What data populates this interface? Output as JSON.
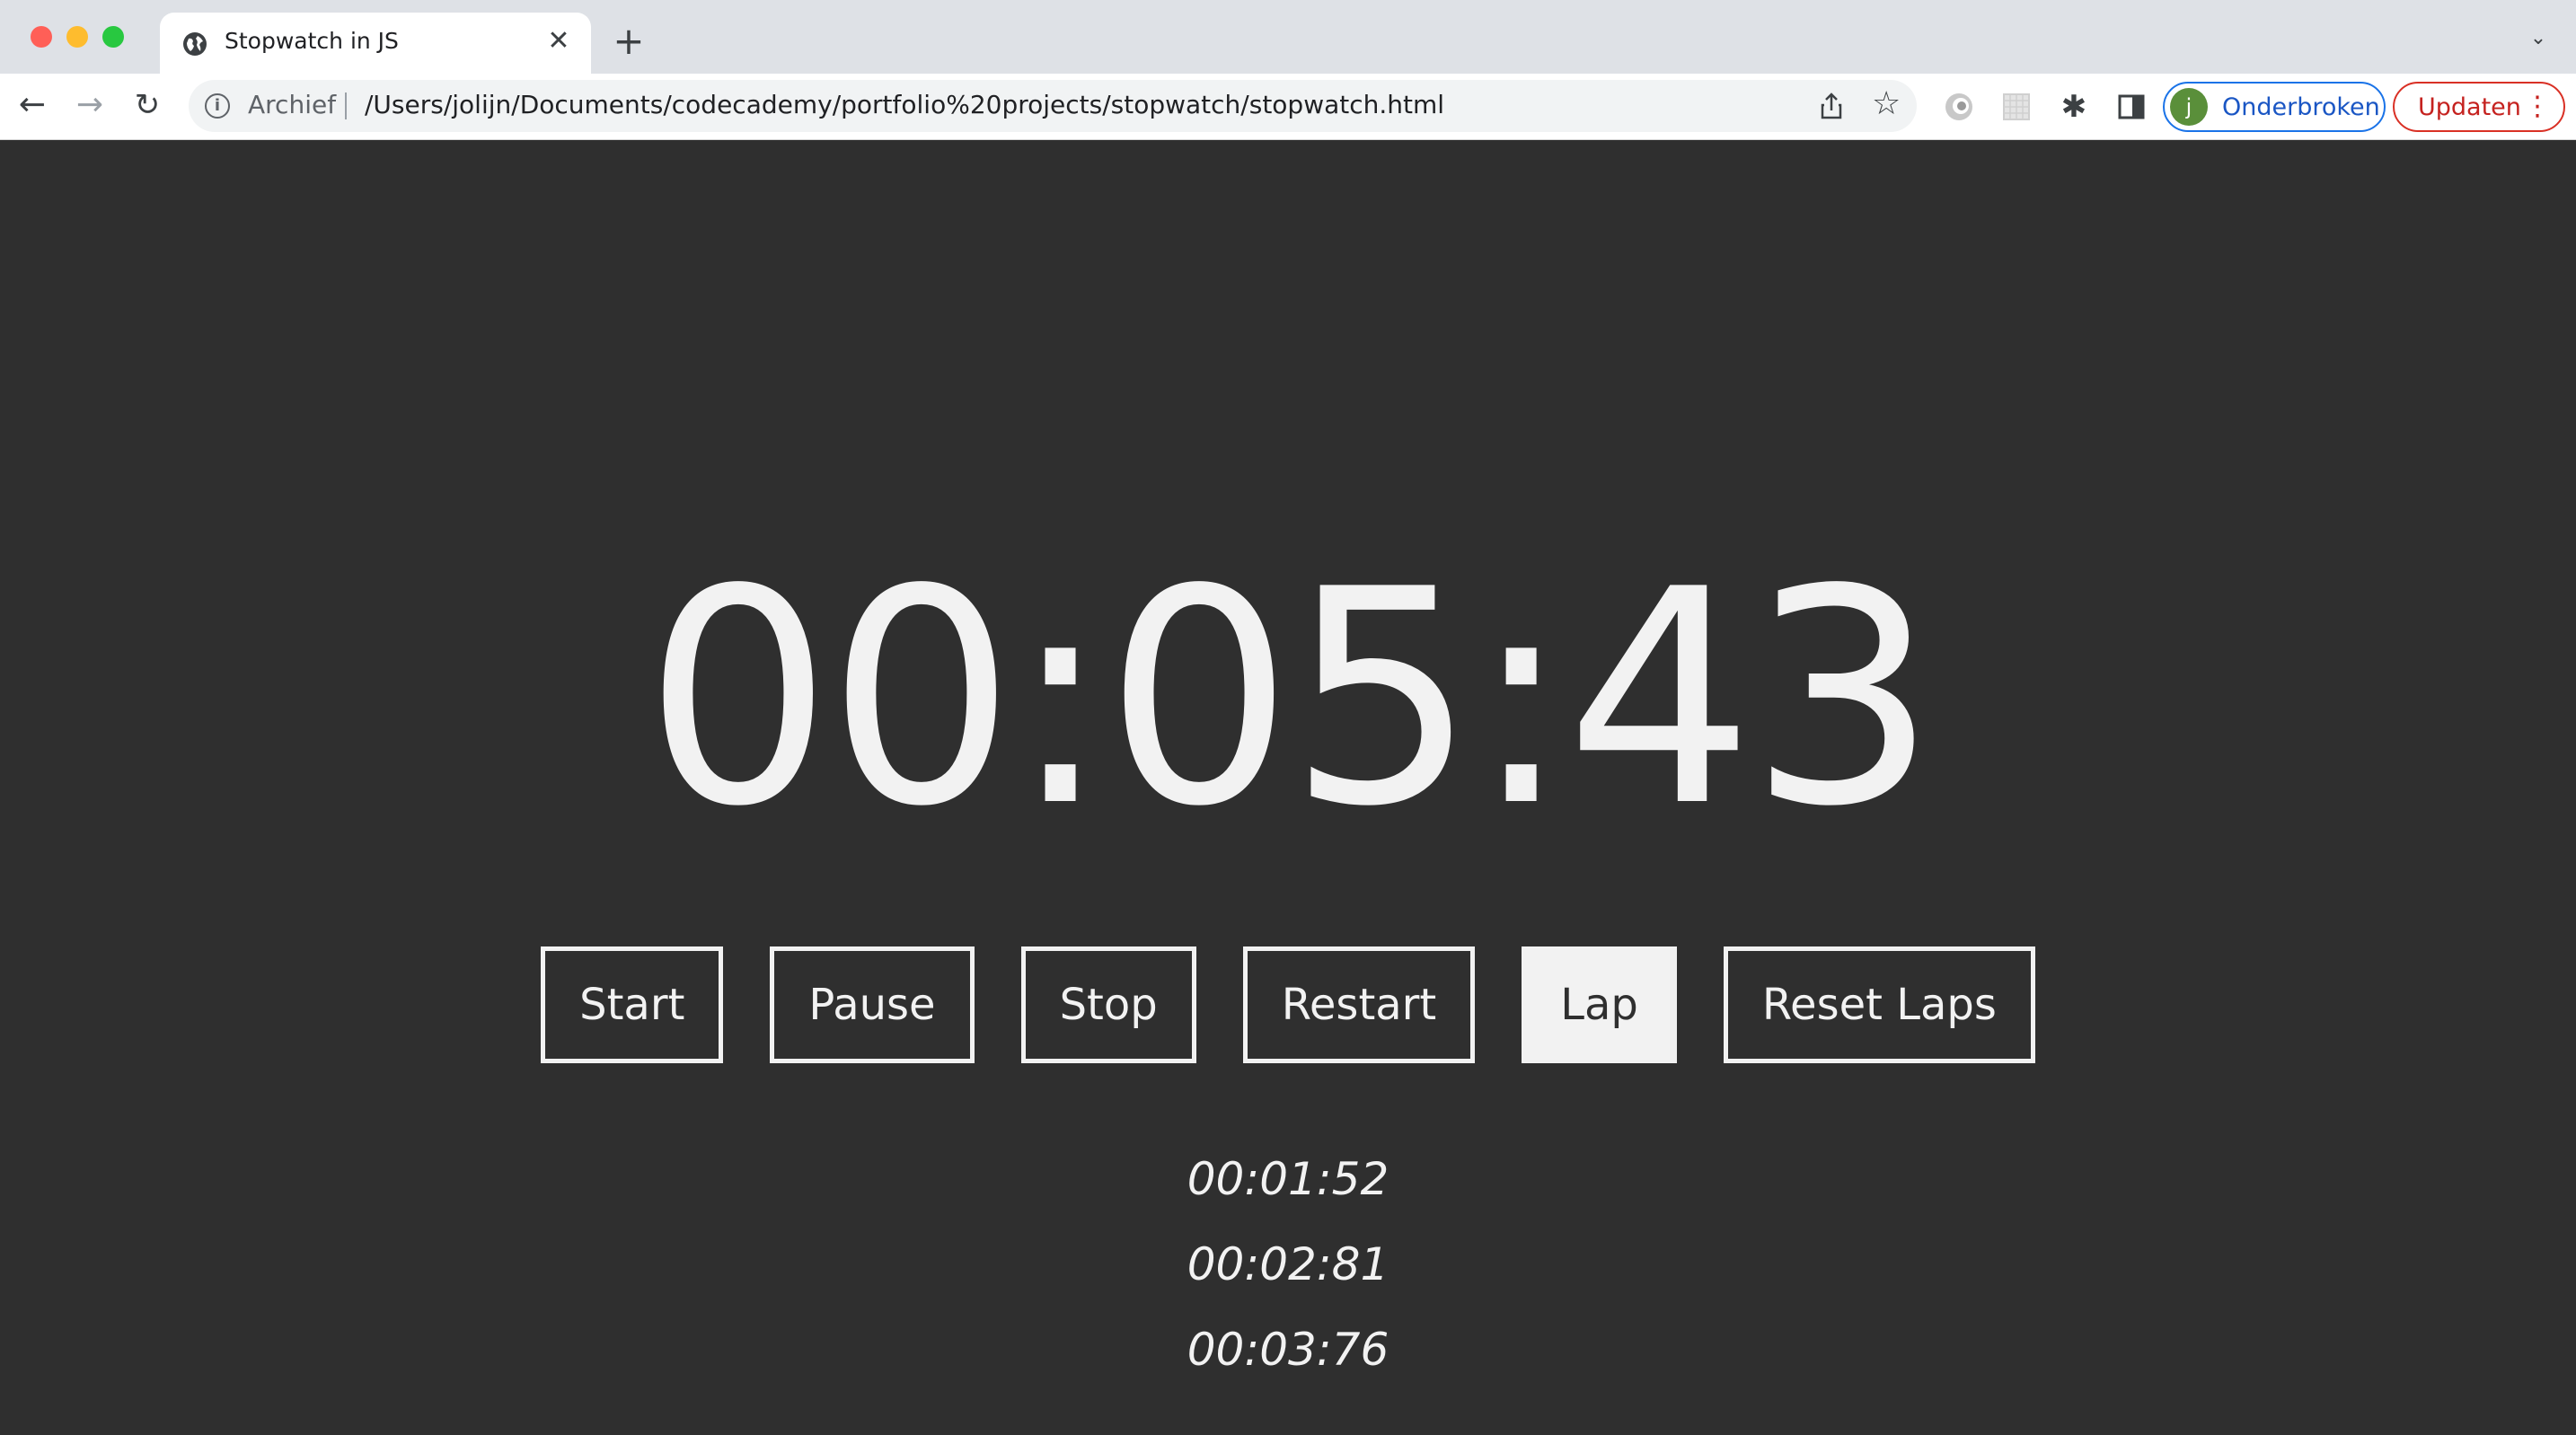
{
  "browser": {
    "tab_title": "Stopwatch in JS",
    "tab_close": "✕",
    "new_tab": "+",
    "tab_search": "⌄",
    "nav": {
      "back": "←",
      "forward": "→",
      "reload": "↻"
    },
    "omnibox": {
      "info": "i",
      "label": "Archief",
      "url": "/Users/jolijn/Documents/codecademy/portfolio%20projects/stopwatch/stopwatch.html",
      "star": "☆"
    },
    "extensions_icon": "✱",
    "profile": {
      "initial": "j",
      "label": "Onderbroken"
    },
    "update": {
      "label": "Updaten",
      "menu": "⋮"
    }
  },
  "stopwatch": {
    "time": "00:05:43",
    "buttons": [
      {
        "label": "Start",
        "active": false
      },
      {
        "label": "Pause",
        "active": false
      },
      {
        "label": "Stop",
        "active": false
      },
      {
        "label": "Restart",
        "active": false
      },
      {
        "label": "Lap",
        "active": true
      },
      {
        "label": "Reset Laps",
        "active": false
      }
    ],
    "laps": [
      "00:01:52",
      "00:02:81",
      "00:03:76"
    ]
  },
  "colors": {
    "page_background": "#2f2f2f",
    "foreground": "#f2f2f2",
    "profile_accent": "#1a73e8",
    "update_accent": "#d93025"
  }
}
